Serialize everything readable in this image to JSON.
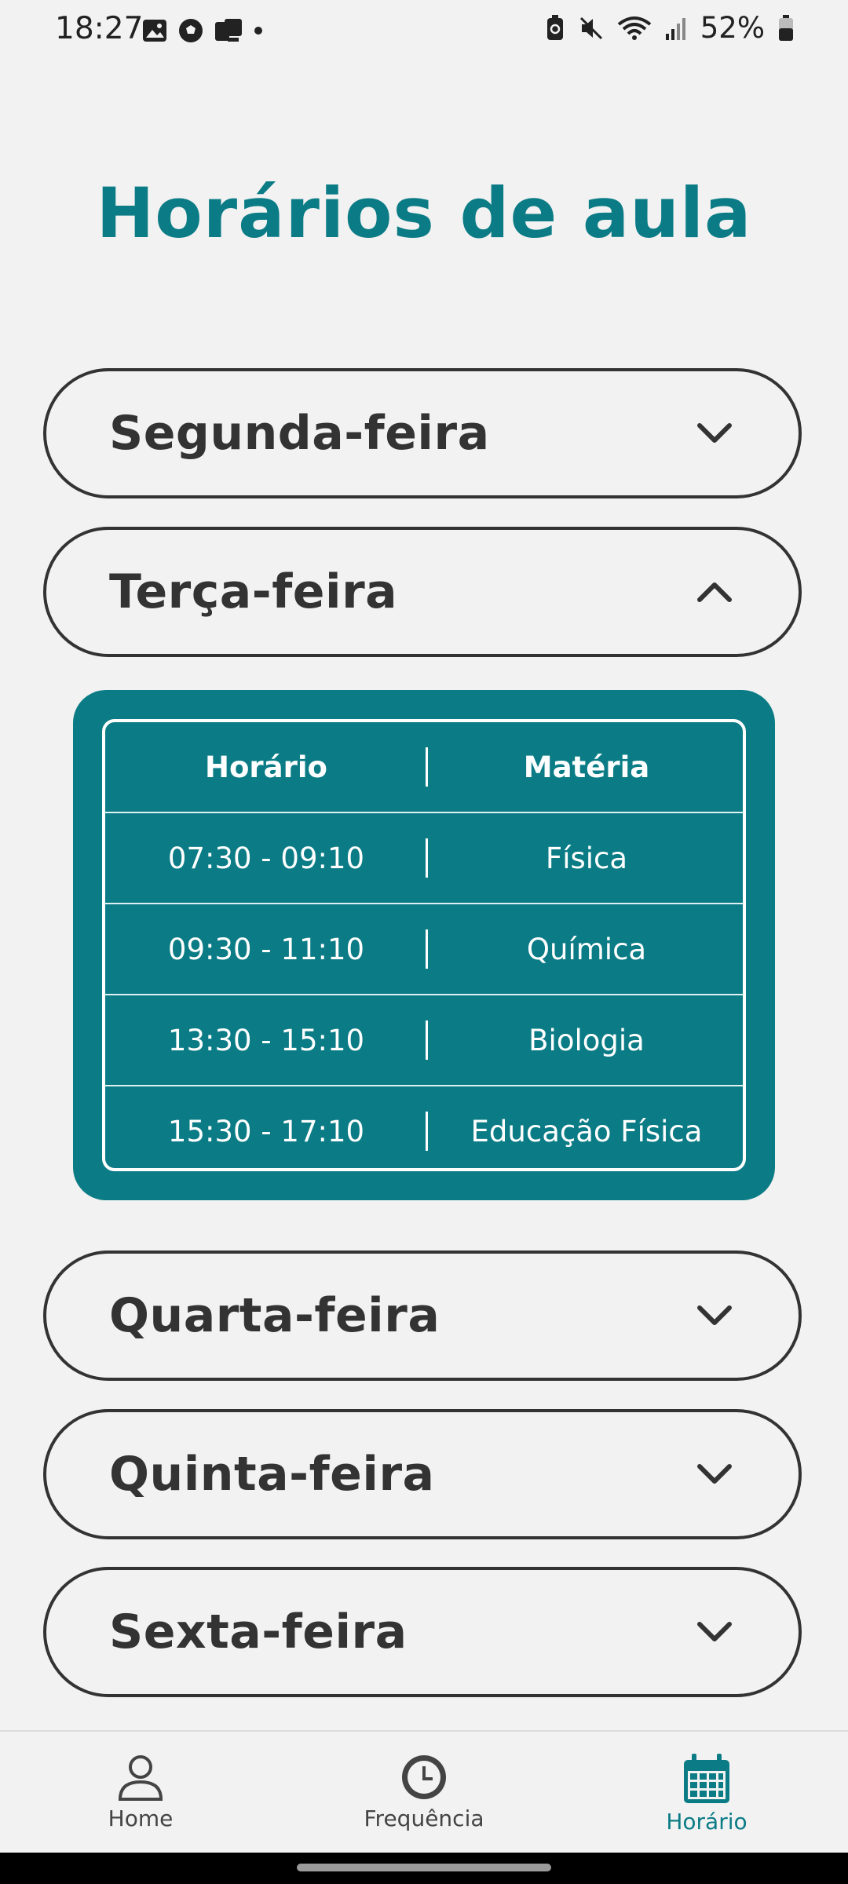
{
  "status_bar": {
    "time": "18:27",
    "battery_text": "52%",
    "icons": [
      "gallery-icon",
      "soccer-ball-icon",
      "cast-icon",
      "dot-icon",
      "battery-saver-icon",
      "mute-icon",
      "wifi-icon",
      "signal-icon",
      "battery-icon"
    ]
  },
  "page": {
    "title": "Horários de aula"
  },
  "days": [
    {
      "label": "Segunda-feira",
      "expanded": false
    },
    {
      "label": "Terça-feira",
      "expanded": true
    },
    {
      "label": "Quarta-feira",
      "expanded": false
    },
    {
      "label": "Quinta-feira",
      "expanded": false
    },
    {
      "label": "Sexta-feira",
      "expanded": false
    }
  ],
  "schedule": {
    "headers": [
      "Horário",
      "Matéria"
    ],
    "rows": [
      {
        "time": "07:30 - 09:10",
        "subject": "Física"
      },
      {
        "time": "09:30 - 11:10",
        "subject": "Química"
      },
      {
        "time": "13:30 - 15:10",
        "subject": "Biologia"
      },
      {
        "time": "15:30 - 17:10",
        "subject": "Educação Física"
      }
    ]
  },
  "bottom_nav": [
    {
      "label": "Home",
      "icon": "person-icon",
      "active": false
    },
    {
      "label": "Frequência",
      "icon": "clock-icon",
      "active": false
    },
    {
      "label": "Horário",
      "icon": "calendar-icon",
      "active": true
    }
  ],
  "colors": {
    "accent": "#0b7c86",
    "background": "#f2f2f2",
    "text": "#333333"
  }
}
